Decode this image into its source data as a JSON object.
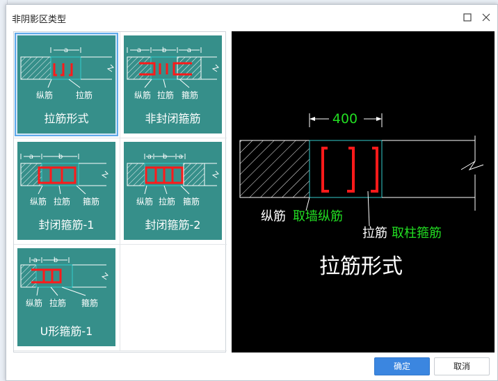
{
  "dialog": {
    "title": "非阴影区类型",
    "ok_label": "确定",
    "cancel_label": "取消"
  },
  "options": [
    {
      "caption": "拉筋形式",
      "labels": [
        "纵筋",
        "拉筋"
      ],
      "dims": [
        "a"
      ],
      "selected": true
    },
    {
      "caption": "非封闭箍筋",
      "labels": [
        "纵筋",
        "拉筋",
        "箍筋"
      ],
      "dims": [
        "a",
        "b",
        "a"
      ],
      "selected": false
    },
    {
      "caption": "封闭箍筋-1",
      "labels": [
        "纵筋",
        "拉筋",
        "箍筋"
      ],
      "dims": [
        "a",
        "b"
      ],
      "selected": false
    },
    {
      "caption": "封闭箍筋-2",
      "labels": [
        "纵筋",
        "拉筋",
        "箍筋"
      ],
      "dims": [
        "a",
        "b",
        "a"
      ],
      "selected": false
    },
    {
      "caption": "U形箍筋-1",
      "labels": [
        "纵筋",
        "拉筋",
        "箍筋"
      ],
      "dims": [
        "a",
        "b"
      ],
      "selected": false
    }
  ],
  "preview": {
    "dimension": "400",
    "label1_prefix": "纵筋",
    "label1_value": "取墙纵筋",
    "label2_prefix": "拉筋",
    "label2_value": "取柱箍筋",
    "caption": "拉筋形式"
  },
  "colors": {
    "thumb_bg": "#368f8a",
    "rebar_red": "#ff1a1a",
    "accent_green": "#22dd22",
    "cyan": "#33cccc",
    "selection_blue": "#5fa9ea",
    "primary_button": "#3b86e0"
  }
}
